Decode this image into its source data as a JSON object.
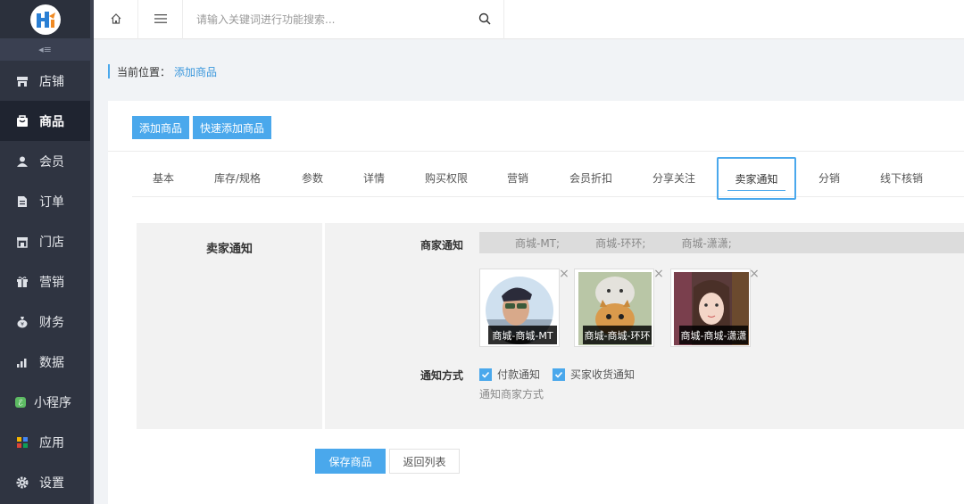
{
  "search": {
    "placeholder": "请输入关键词进行功能搜索..."
  },
  "sidebar": {
    "collapse_label": "◂≡",
    "items": [
      {
        "label": "店铺",
        "icon": "store-icon"
      },
      {
        "label": "商品",
        "icon": "goods-icon",
        "active": true
      },
      {
        "label": "会员",
        "icon": "user-icon"
      },
      {
        "label": "订单",
        "icon": "order-icon"
      },
      {
        "label": "门店",
        "icon": "shop-icon"
      },
      {
        "label": "营销",
        "icon": "gift-icon"
      },
      {
        "label": "财务",
        "icon": "money-bag-icon"
      },
      {
        "label": "数据",
        "icon": "bar-chart-icon"
      },
      {
        "label": "小程序",
        "icon": "miniprogram-icon"
      },
      {
        "label": "应用",
        "icon": "apps-icon"
      },
      {
        "label": "设置",
        "icon": "gear-icon"
      }
    ]
  },
  "breadcrumb": {
    "label": "当前位置：",
    "current": "添加商品"
  },
  "toolbar": {
    "add_label": "添加商品",
    "quick_add_label": "快速添加商品"
  },
  "tabs": [
    "基本",
    "库存/规格",
    "参数",
    "详情",
    "购买权限",
    "营销",
    "会员折扣",
    "分享关注",
    "卖家通知",
    "分销",
    "线下核销"
  ],
  "active_tab": "卖家通知",
  "section": {
    "title": "卖家通知",
    "merchant_label": "商家通知",
    "merchants_line": [
      "商城-MT;",
      "商城-环环;",
      "商城-潇潇;"
    ],
    "avatars": [
      {
        "name": "商城-商城-MT"
      },
      {
        "name": "商城-商城-环环"
      },
      {
        "name": "商城-商城-潇潇"
      }
    ],
    "notify_label": "通知方式",
    "options": [
      {
        "label": "付款通知",
        "checked": true
      },
      {
        "label": "买家收货通知",
        "checked": true
      }
    ],
    "hint": "通知商家方式"
  },
  "actions": {
    "save_label": "保存商品",
    "back_label": "返回列表"
  },
  "colors": {
    "accent": "#4aa8ec",
    "sidebar": "#2f3441",
    "sidebar_active": "#1f2430"
  }
}
